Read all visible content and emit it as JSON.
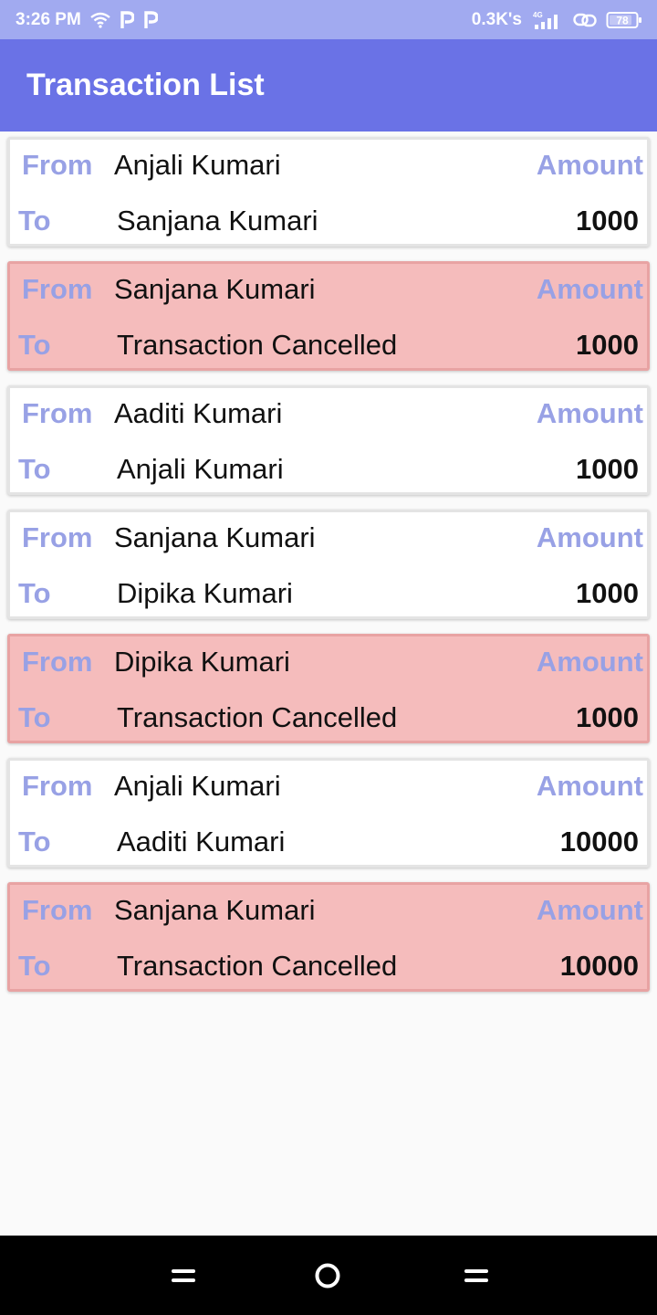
{
  "status_bar": {
    "time": "3:26 PM",
    "speed": "0.3K's",
    "network": "4G",
    "battery": "78",
    "icons": [
      "wifi-icon",
      "p-app-icon",
      "p-app-icon",
      "signal-icon",
      "link-icon",
      "battery-icon"
    ]
  },
  "app_bar": {
    "title": "Transaction List"
  },
  "labels": {
    "from": "From",
    "to": "To",
    "amount": "Amount"
  },
  "transactions": [
    {
      "from": "Anjali Kumari",
      "to": "Sanjana Kumari",
      "amount": "1000",
      "cancelled": false
    },
    {
      "from": "Sanjana Kumari",
      "to": "Transaction Cancelled",
      "amount": "1000",
      "cancelled": true
    },
    {
      "from": "Aaditi Kumari",
      "to": "Anjali Kumari",
      "amount": "1000",
      "cancelled": false
    },
    {
      "from": "Sanjana Kumari",
      "to": "Dipika Kumari",
      "amount": "1000",
      "cancelled": false
    },
    {
      "from": "Dipika Kumari",
      "to": "Transaction Cancelled",
      "amount": "1000",
      "cancelled": true
    },
    {
      "from": "Anjali Kumari",
      "to": "Aaditi Kumari",
      "amount": "10000",
      "cancelled": false
    },
    {
      "from": "Sanjana Kumari",
      "to": "Transaction Cancelled",
      "amount": "10000",
      "cancelled": true
    }
  ],
  "colors": {
    "status_bar": "#a1aaf0",
    "app_bar": "#6a72e6",
    "label": "#98a1e5",
    "cancelled_card": "#f5bcbc",
    "normal_card": "#ffffff"
  },
  "nav_bar": {
    "icons": [
      "menu-icon",
      "home-icon",
      "back-icon"
    ]
  }
}
